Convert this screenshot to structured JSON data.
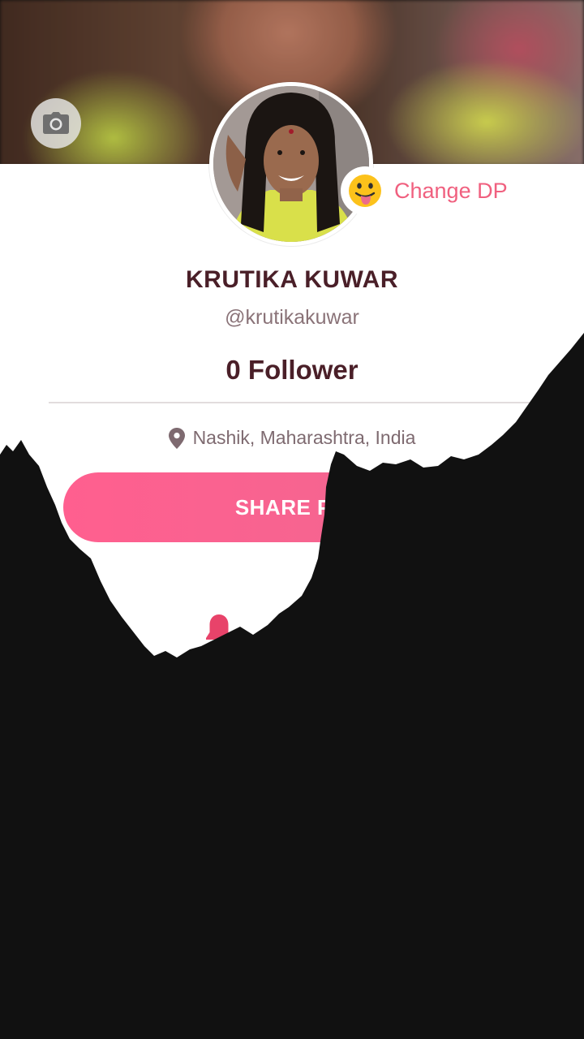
{
  "profile": {
    "name": "KRUTIKA KUWAR",
    "handle": "@krutikakuwar",
    "followers": "0 Follower",
    "location": "Nashik, Maharashtra, India",
    "change_dp_label": "Change DP",
    "change_dp_emoji": "😛"
  },
  "actions": {
    "share_label": "SHARE PR"
  },
  "icons": {
    "camera": "camera-icon",
    "location": "location-pin-icon",
    "bell": "bell-icon",
    "emoji": "tongue-out-emoji-icon"
  },
  "colors": {
    "accent": "#f0607f",
    "button": "#ff5f8f",
    "name_text": "#4a1f28",
    "muted_text": "#8a7378",
    "overlay": "#111111"
  }
}
